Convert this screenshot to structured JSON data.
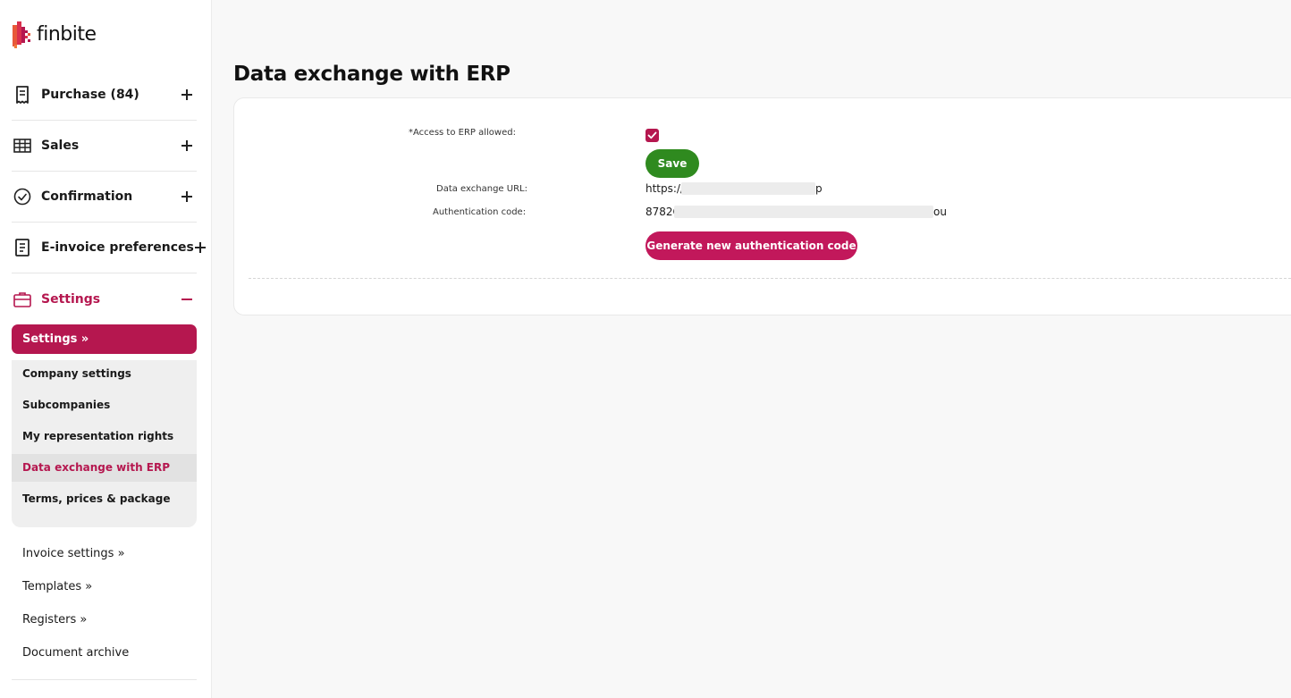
{
  "brand": {
    "name": "finbite",
    "accent": "#b5174f",
    "save_green": "#2f8a1f"
  },
  "sidebar": {
    "sections": [
      {
        "label": "Purchase (84)",
        "icon": "receipt-icon",
        "state": "collapsed"
      },
      {
        "label": "Sales",
        "icon": "table-icon",
        "state": "collapsed"
      },
      {
        "label": "Confirmation",
        "icon": "check-circle-icon",
        "state": "collapsed"
      },
      {
        "label": "E-invoice preferences",
        "icon": "document-icon",
        "state": "collapsed"
      },
      {
        "label": "Settings",
        "icon": "briefcase-icon",
        "state": "expanded"
      }
    ],
    "settings_header": "Settings »",
    "settings_items": [
      {
        "label": "Company settings"
      },
      {
        "label": "Subcompanies"
      },
      {
        "label": "My representation rights"
      },
      {
        "label": "Data exchange with ERP",
        "active": true
      },
      {
        "label": "Terms, prices & package"
      }
    ],
    "links": [
      {
        "label": "Invoice settings »"
      },
      {
        "label": "Templates »"
      },
      {
        "label": "Registers »"
      },
      {
        "label": "Document archive"
      }
    ]
  },
  "main": {
    "title": "Data exchange with ERP",
    "form": {
      "access_label": "*Access to ERP allowed:",
      "access_checked": true,
      "save_label": "Save",
      "url_label": "Data exchange URL:",
      "url_prefix": "https://",
      "url_suffix": "p",
      "auth_label": "Authentication code:",
      "auth_prefix": "8782C",
      "auth_suffix": "ou",
      "generate_label": "Generate new authentication code"
    }
  }
}
